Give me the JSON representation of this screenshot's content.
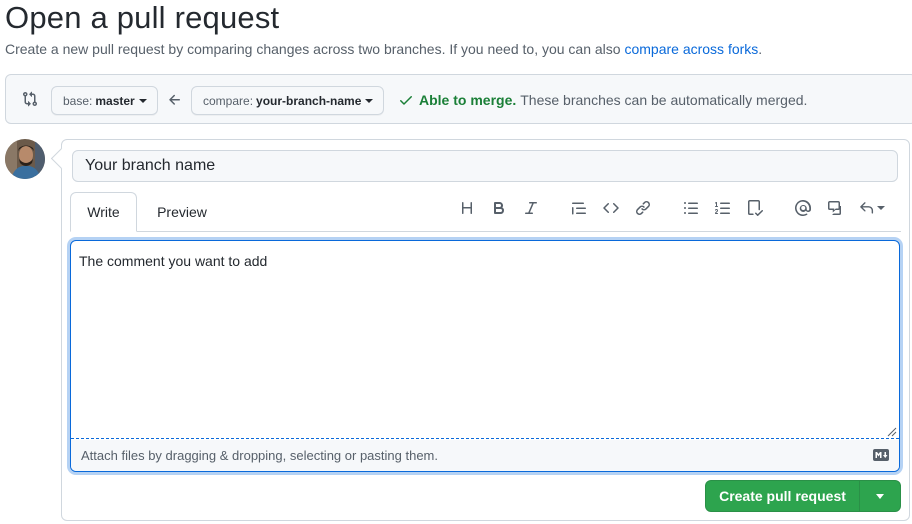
{
  "page": {
    "title": "Open a pull request",
    "subtitle_text": "Create a new pull request by comparing changes across two branches. If you need to, you can also ",
    "subtitle_link": "compare across forks",
    "subtitle_end": "."
  },
  "compare": {
    "icon": "git-compare-icon",
    "base_prefix": "base:",
    "base_branch": "master",
    "arrow_icon": "arrow-left-icon",
    "compare_prefix": "compare:",
    "compare_branch": "your-branch-name",
    "merge_ok": "Able to merge.",
    "merge_text": "These branches can be automatically merged.",
    "merge_color": "#1a7f37"
  },
  "form": {
    "title_value": "Your branch name",
    "tabs": [
      {
        "label": "Write",
        "active": true
      },
      {
        "label": "Preview",
        "active": false
      }
    ],
    "toolbar": [
      "heading-icon",
      "bold-icon",
      "italic-icon",
      "quote-icon",
      "code-icon",
      "link-icon",
      "unordered-list-icon",
      "ordered-list-icon",
      "tasklist-icon",
      "mention-icon",
      "cross-reference-icon",
      "reply-icon"
    ],
    "comment_value": "The comment you want to add",
    "attach_text": "Attach files by dragging & dropping, selecting or pasting them.",
    "markdown_icon": "markdown-icon"
  },
  "actions": {
    "create_label": "Create pull request",
    "primary_color": "#2da44e"
  }
}
